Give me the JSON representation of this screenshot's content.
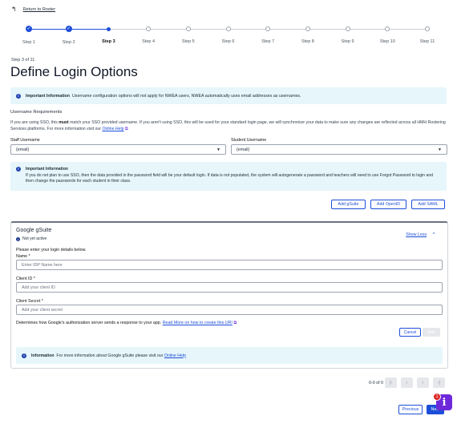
{
  "nav": {
    "back_label": "Return to Roster"
  },
  "steps": [
    "Step 1",
    "Step 2",
    "Step 3",
    "Step 4",
    "Step 5",
    "Step 6",
    "Step 7",
    "Step 8",
    "Step 9",
    "Step 10",
    "Step 11"
  ],
  "page": {
    "subtitle": "Step 3 of 11",
    "title": "Define Login Options"
  },
  "important_info": {
    "label": "Important Information",
    "text": "Username configuration options will not apply for NWEA users, NWEA automatically uses email addresses as usernames."
  },
  "username_requirements": {
    "title": "Username Requirements",
    "text_before": "If you are using SSO, this ",
    "text_bold": "must",
    "text_after": " match your SSO provided username. If you aren't using SSO, this will be used for your standard login page, we will synchronize your data to make sure any changes are reflected across all HMH Rostering Services platforms. For more information visit our ",
    "link": "Online Help"
  },
  "staff_username": {
    "label": "Staff Username",
    "value": "{email}"
  },
  "student_username": {
    "label": "Student Username",
    "value": "{email}"
  },
  "password_info": {
    "label": "Important Information",
    "text": "If you do not plan to use SSO, then the data provided in the password field will be your default login. If data is not populated, the system will autogenerate a password and teachers will need to use Forgot Password to login and then change the passwords for each student in their class."
  },
  "add_buttons": {
    "gsuite": "Add gSuite",
    "openid": "Add OpenID",
    "saml": "Add SAML"
  },
  "gsuite_card": {
    "title": "Google gSuite",
    "status": "Not yet active",
    "show_less": "Show Less",
    "instructions": "Please enter your login details below.",
    "name_label": "Name *",
    "name_placeholder": "Enter IDP Name here",
    "client_id_label": "Client ID *",
    "client_id_placeholder": "Add your client ID",
    "client_secret_label": "Client Secret *",
    "client_secret_placeholder": "Add your client secret",
    "determines_text": "Determines how Google's authorization server sends a response to your app.",
    "determines_link": "Read More on how to create this URI",
    "cancel": "Cancel",
    "add": "Add",
    "info_label": "Information",
    "info_text": "For more information about Google gSuite please visit our",
    "info_link": "Online Help"
  },
  "pager": {
    "text": "0-0 of 0"
  },
  "footer": {
    "previous": "Previous",
    "next": "Next",
    "help_badge": "1",
    "help_icon": "i"
  },
  "colors": {
    "primary": "#1d4ed8",
    "info_bg": "#e6f6fa",
    "help": "#6d28d9",
    "badge": "#dc2626"
  }
}
